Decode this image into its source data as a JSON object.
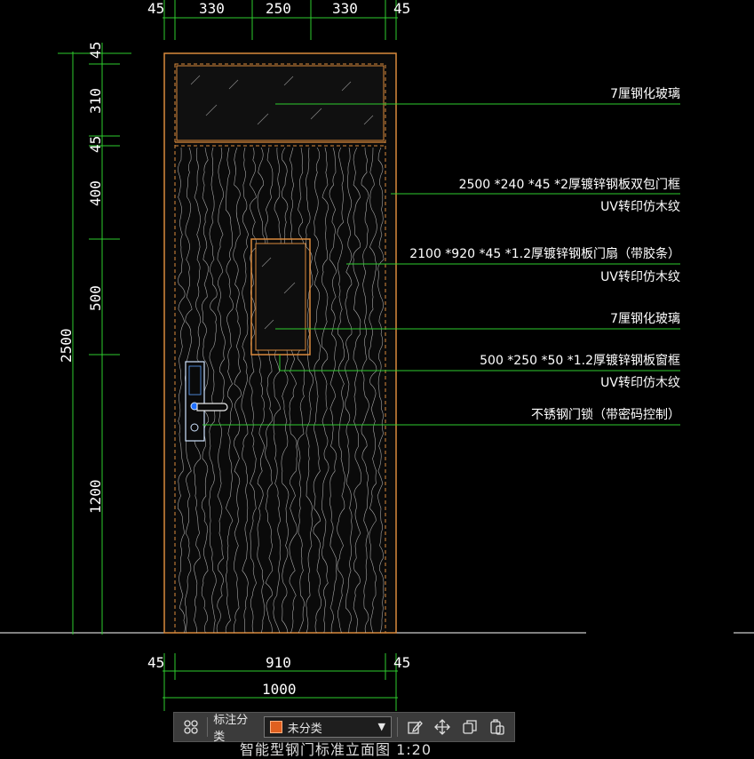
{
  "drawing": {
    "top_dims": [
      "45",
      "330",
      "250",
      "330",
      "45"
    ],
    "bottom_dims": [
      "45",
      "910",
      "45"
    ],
    "bottom_total": "1000",
    "left_dims": [
      "45",
      "310",
      "45",
      "400",
      "500",
      "1200"
    ],
    "left_total": "2500",
    "annotations": [
      {
        "lines": [
          "7厘钢化玻璃"
        ]
      },
      {
        "lines": [
          "2500 *240 *45 *2厚镀锌钢板双包门框",
          "UV转印仿木纹"
        ]
      },
      {
        "lines": [
          "2100 *920 *45 *1.2厚镀锌钢板门扇（带胶条）",
          "UV转印仿木纹"
        ]
      },
      {
        "lines": [
          "7厘钢化玻璃"
        ]
      },
      {
        "lines": [
          "500 *250 *50 *1.2厚镀锌钢板窗框",
          "UV转印仿木纹"
        ]
      },
      {
        "lines": [
          "不锈钢门锁（带密码控制）"
        ]
      }
    ],
    "footer_title": "智能型钢门标准立面图  1:20"
  },
  "toolbar": {
    "category_label": "标注分类",
    "category_value": "未分类",
    "category_color": "#e06020",
    "icons": [
      "grid-icon",
      "edit-icon",
      "move-icon",
      "copy-icon",
      "paste-icon"
    ]
  }
}
